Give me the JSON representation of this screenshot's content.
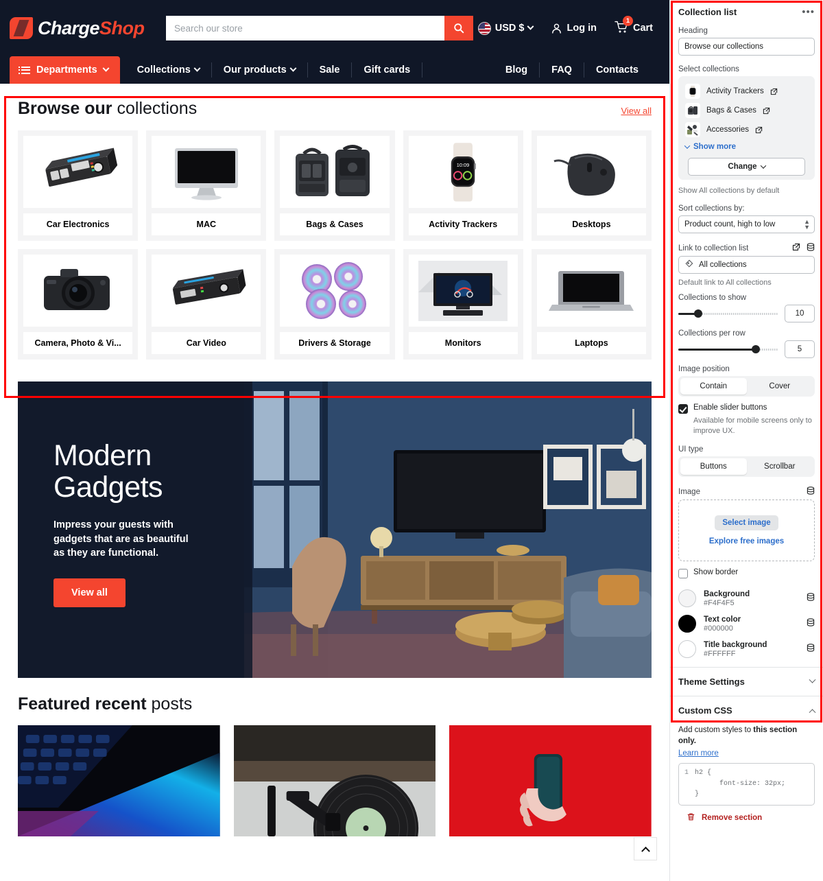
{
  "store": {
    "brand": {
      "name_bold": "Charge",
      "name_light": "Shop"
    },
    "search": {
      "placeholder": "Search our store",
      "icon": "search-icon"
    },
    "currency": {
      "label": "USD $",
      "icon": "us-flag-icon"
    },
    "account": {
      "label": "Log in",
      "icon": "user-icon"
    },
    "cart": {
      "label": "Cart",
      "count": "1",
      "icon": "cart-icon"
    },
    "nav": {
      "departments": "Departments",
      "left_links": [
        {
          "label": "Collections",
          "has_caret": true
        },
        {
          "label": "Our products",
          "has_caret": true
        },
        {
          "label": "Sale",
          "has_caret": false
        },
        {
          "label": "Gift cards",
          "has_caret": false
        }
      ],
      "right_links": [
        {
          "label": "Blog"
        },
        {
          "label": "FAQ"
        },
        {
          "label": "Contacts"
        }
      ]
    },
    "collections_section": {
      "title_bold": "Browse our",
      "title_light": "collections",
      "view_all": "View all",
      "cards": [
        {
          "title": "Car Electronics",
          "image": "car-power-inverter-image"
        },
        {
          "title": "MAC",
          "image": "imac-desktop-image"
        },
        {
          "title": "Bags & Cases",
          "image": "camera-backpack-image"
        },
        {
          "title": "Activity Trackers",
          "image": "smartwatch-image"
        },
        {
          "title": "Desktops",
          "image": "computer-mouse-image"
        },
        {
          "title": "Camera, Photo & Vi...",
          "image": "dslr-camera-image"
        },
        {
          "title": "Car Video",
          "image": "car-amplifier-image"
        },
        {
          "title": "Drivers & Storage",
          "image": "cd-discs-image"
        },
        {
          "title": "Monitors",
          "image": "desktop-monitor-image"
        },
        {
          "title": "Laptops",
          "image": "laptop-image"
        }
      ]
    },
    "hero": {
      "heading_line1": "Modern",
      "heading_line2": "Gadgets",
      "body": "Impress your guests with gadgets that are as beautiful as they are functional.",
      "button": "View all",
      "image": "blue-living-room-interior-image"
    },
    "posts_section": {
      "title_bold": "Featured recent",
      "title_light": "posts",
      "posts": [
        {
          "image": "macbook-keyboard-neon-image"
        },
        {
          "image": "vinyl-turntable-image"
        },
        {
          "image": "hand-holding-phone-red-image"
        }
      ]
    },
    "scroll_top": {
      "icon": "chevron-up-icon"
    }
  },
  "sidebar": {
    "section_title": "Collection list",
    "overflow_menu": "•••",
    "heading_label": "Heading",
    "heading_value": "Browse our collections",
    "select_collections_label": "Select collections",
    "collections": [
      {
        "name": "Activity Trackers",
        "thumb": "smartwatch-thumb"
      },
      {
        "name": "Bags & Cases",
        "thumb": "camera-bag-thumb"
      },
      {
        "name": "Accessories",
        "thumb": "accessories-thumb"
      }
    ],
    "show_more": "Show more",
    "change_button": "Change",
    "show_all_help": "Show All collections by default",
    "sort_label": "Sort collections by:",
    "sort_value": "Product count, high to low",
    "sort_options": [
      "Product count, high to low"
    ],
    "link_label": "Link to collection list",
    "link_value": "All collections",
    "link_help": "Default link to All collections",
    "collections_to_show": {
      "label": "Collections to show",
      "value": "10",
      "fill_percent": 20
    },
    "collections_per_row": {
      "label": "Collections per row",
      "value": "5",
      "fill_percent": 78
    },
    "image_position": {
      "label": "Image position",
      "options": [
        "Contain",
        "Cover"
      ],
      "selected": "Contain"
    },
    "slider_buttons": {
      "label": "Enable slider buttons",
      "checked": true,
      "help": "Available for mobile screens only to improve UX."
    },
    "ui_type": {
      "label": "UI type",
      "options": [
        "Buttons",
        "Scrollbar"
      ],
      "selected": "Buttons"
    },
    "image": {
      "label": "Image",
      "select_button": "Select image",
      "explore_link": "Explore free images"
    },
    "show_border": {
      "label": "Show border",
      "checked": false
    },
    "colors": [
      {
        "name": "Background",
        "hex": "#F4F4F5"
      },
      {
        "name": "Text color",
        "hex": "#000000"
      },
      {
        "name": "Title background",
        "hex": "#FFFFFF"
      }
    ],
    "theme_settings": "Theme Settings",
    "custom_css": {
      "title": "Custom CSS",
      "desc_prefix": "Add custom styles to ",
      "desc_bold": "this section only.",
      "learn_more": "Learn more",
      "code_lines": [
        "h2 {",
        "      font-size: 32px;",
        "}"
      ],
      "gutter": "1"
    },
    "remove_section": "Remove section"
  }
}
